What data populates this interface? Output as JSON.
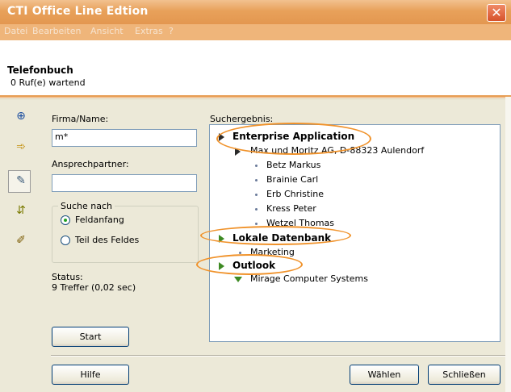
{
  "window": {
    "title": "CTI Office Line Edtion"
  },
  "menu": [
    "Datei",
    "Bearbeiten",
    "Ansicht",
    "Extras",
    "?"
  ],
  "header": {
    "title": "Telefonbuch",
    "subtitle": "0 Ruf(e) wartend"
  },
  "toolbar": {
    "icons": [
      "phone-down-icon",
      "forward-arrow-icon",
      "phonebook-icon",
      "transfer-arrows-icon",
      "notes-icon"
    ]
  },
  "search": {
    "firma_label": "Firma/Name:",
    "firma_value": "m*",
    "ansprech_label": "Ansprechpartner:",
    "ansprech_value": "",
    "group_label": "Suche nach",
    "radio_options": [
      {
        "label": "Feldanfang",
        "selected": true
      },
      {
        "label": "Teil des Feldes",
        "selected": false
      }
    ]
  },
  "status": {
    "label": "Status:",
    "value": "9 Treffer (0,02 sec)"
  },
  "results": {
    "label": "Suchergebnis:",
    "tree": [
      {
        "text": "Enterprise Application"
      },
      {
        "text": "Max und Moritz AG, D-88323 Aulendorf"
      },
      {
        "text": "Betz Markus"
      },
      {
        "text": "Brainie Carl"
      },
      {
        "text": "Erb Christine"
      },
      {
        "text": "Kress Peter"
      },
      {
        "text": "Wetzel Thomas"
      },
      {
        "text": "Lokale Datenbank"
      },
      {
        "text": "Marketing"
      },
      {
        "text": "Outlook"
      },
      {
        "text": "Mirage Computer Systems"
      }
    ]
  },
  "buttons": {
    "start": "Start",
    "hilfe": "Hilfe",
    "waehlen": "Wählen",
    "schliessen": "Schließen"
  },
  "colors": {
    "title_bar": "#e8a15a",
    "highlight_oval": "#f0922a",
    "menu_bar": "#efb57a"
  }
}
